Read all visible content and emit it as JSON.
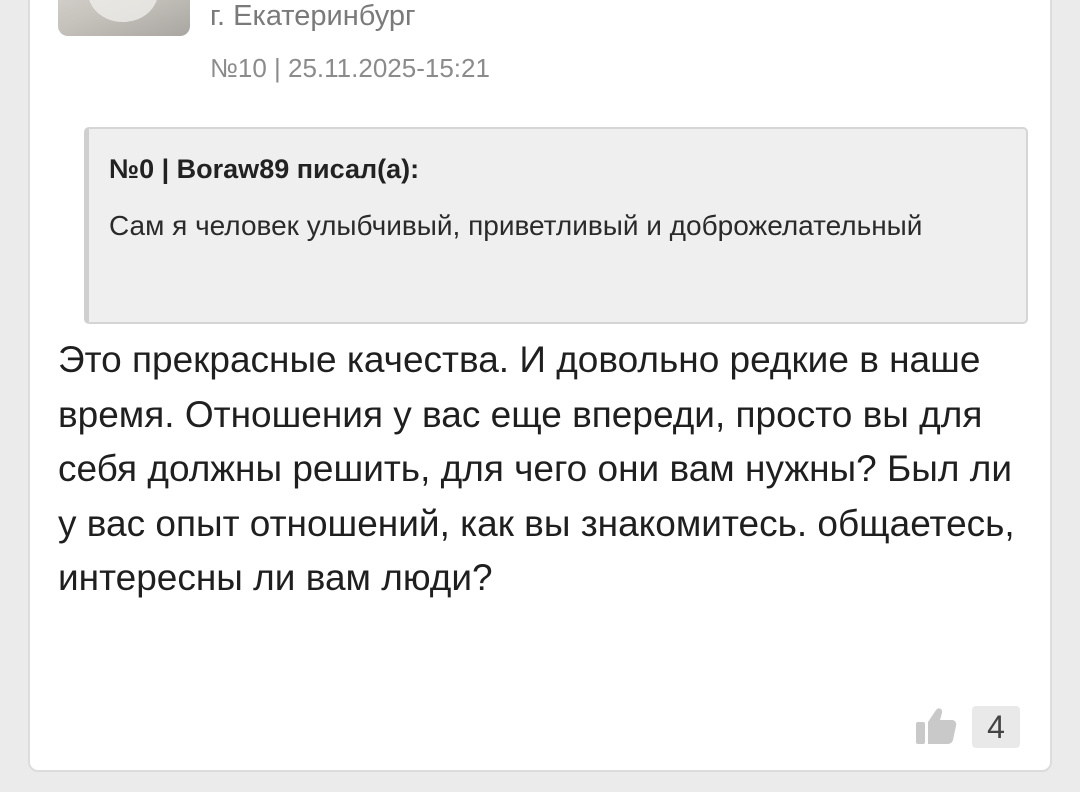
{
  "author": {
    "city": "г. Екатеринбург",
    "meta": "№10 | 25.11.2025-15:21"
  },
  "quote": {
    "header": "№0 | Boraw89 писал(а):",
    "text": "Сам я человек улыбчивый, приветливый и доброжелательный"
  },
  "post": {
    "body": "Это прекрасные качества. И довольно редкие в наше время. Отношения у вас еще впереди, просто вы для себя должны решить, для чего они вам нужны? Был ли у вас опыт отношений, как вы знакомитесь. общаетесь, интересны ли вам люди?"
  },
  "likes": {
    "icon": "thumbs-up-icon",
    "count": "4"
  },
  "colors": {
    "page_background": "#ebebeb",
    "card_background": "#ffffff",
    "quote_background": "#efefef",
    "muted_text": "#8b8b8b"
  }
}
